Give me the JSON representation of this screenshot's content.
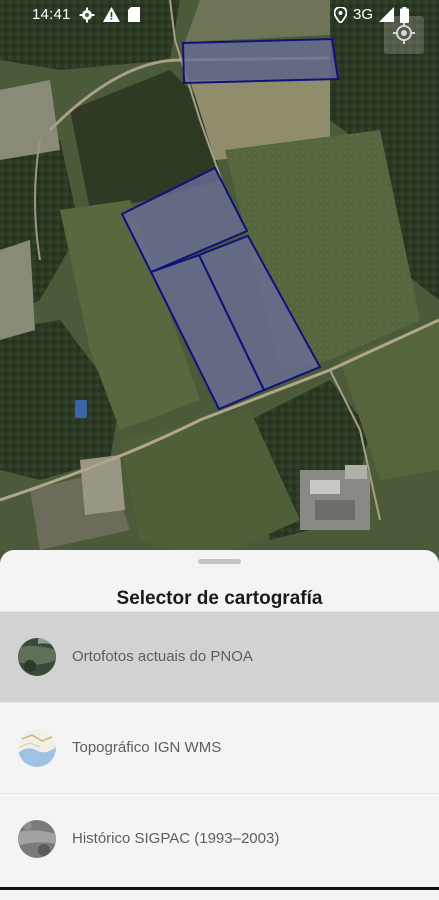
{
  "status_bar": {
    "time": "14:41",
    "network": "3G",
    "icons_left": [
      "settings-icon",
      "warning-icon",
      "sim-card-icon"
    ],
    "icons_right": [
      "location-pin-icon",
      "signal-icon",
      "battery-icon"
    ]
  },
  "map": {
    "parcel_fill": "#6b6d9a",
    "parcel_stroke": "#10127a",
    "locate_icon": "my-location-icon"
  },
  "sheet": {
    "title": "Selector de cartografía",
    "layers": [
      {
        "label": "Ortofotos actuais do PNOA",
        "thumb": "orthophoto-thumb",
        "selected": true
      },
      {
        "label": "Topográfico IGN WMS",
        "thumb": "topographic-thumb",
        "selected": false
      },
      {
        "label": "Histórico SIGPAC (1993–2003)",
        "thumb": "historic-thumb",
        "selected": false
      }
    ]
  }
}
